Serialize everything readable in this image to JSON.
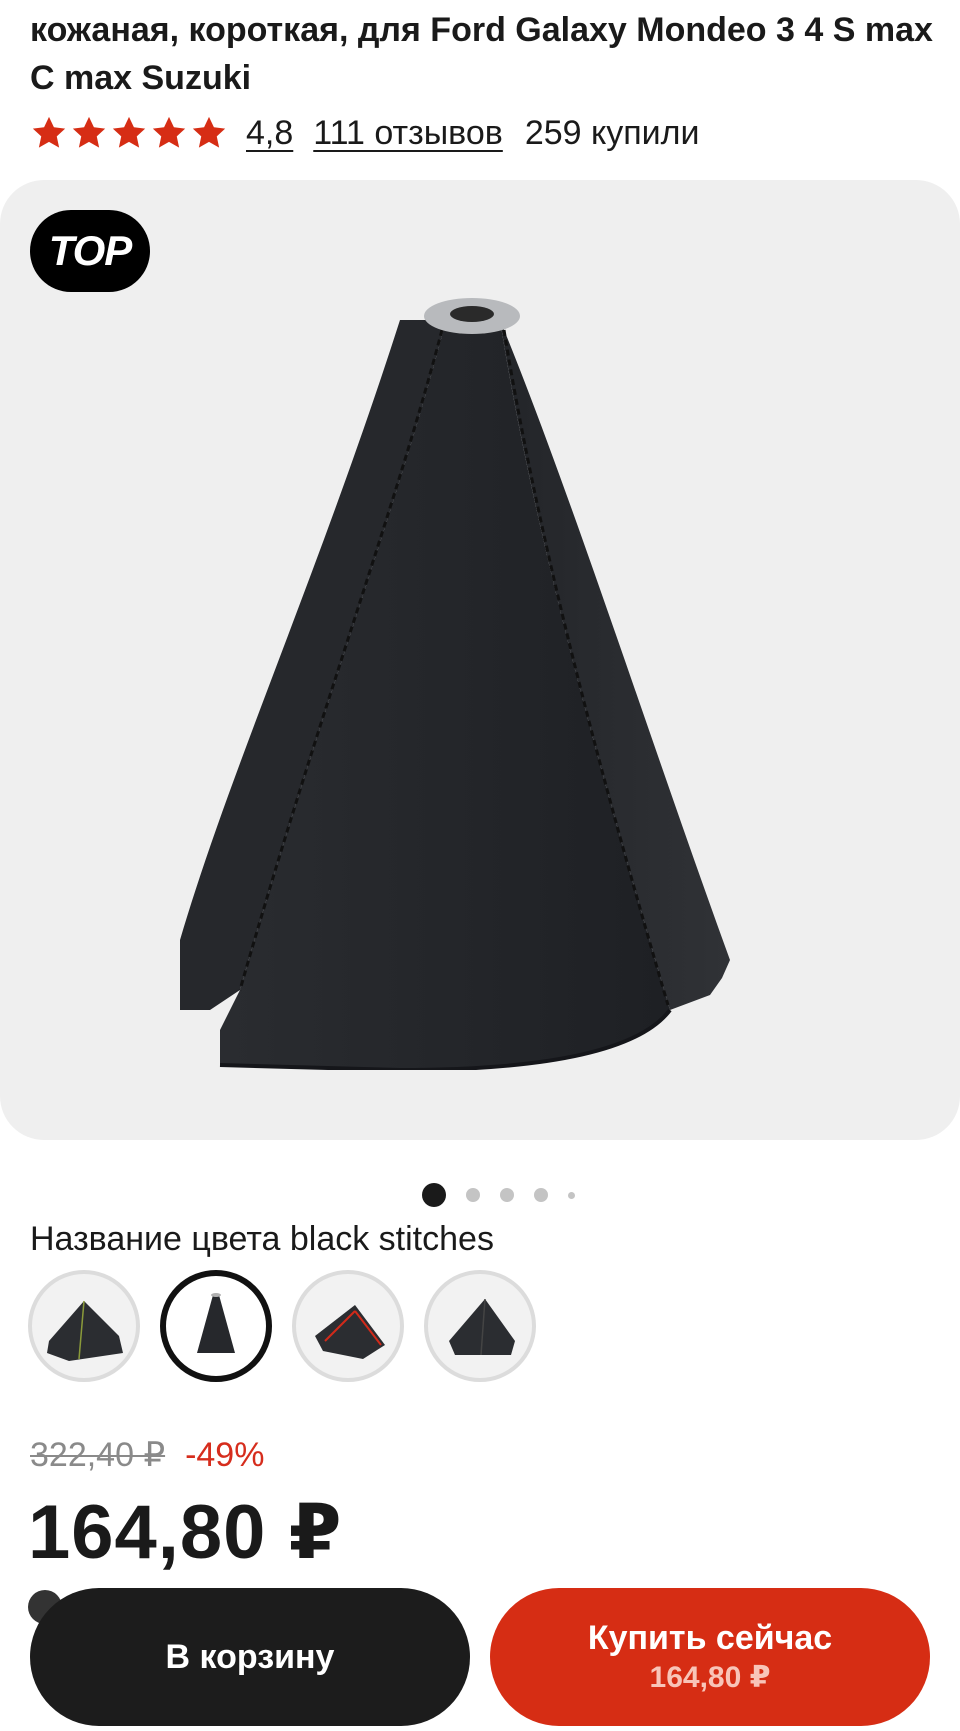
{
  "product": {
    "title": "кожаная, короткая, для Ford Galaxy Mondeo 3 4 S max C max Suzuki",
    "rating": "4,8",
    "reviews": "111 отзывов",
    "bought": "259 купили",
    "badge": "TOP"
  },
  "colors": {
    "label": "Название цвета black stitches",
    "options": [
      "option-1",
      "option-2-selected",
      "option-3",
      "option-4"
    ]
  },
  "pricing": {
    "old_price": "322,40 ₽",
    "discount": "-49%",
    "price": "164,80 ₽"
  },
  "actions": {
    "cart_label": "В корзину",
    "buy_label": "Купить сейчас",
    "buy_price": "164,80 ₽"
  },
  "icons": {
    "star": "star-icon",
    "badge": "top-badge"
  },
  "theme": {
    "accent": "#d62d14",
    "star_color": "#d62d14",
    "dark_button": "#1c1c1c",
    "gallery_bg": "#efefef"
  }
}
